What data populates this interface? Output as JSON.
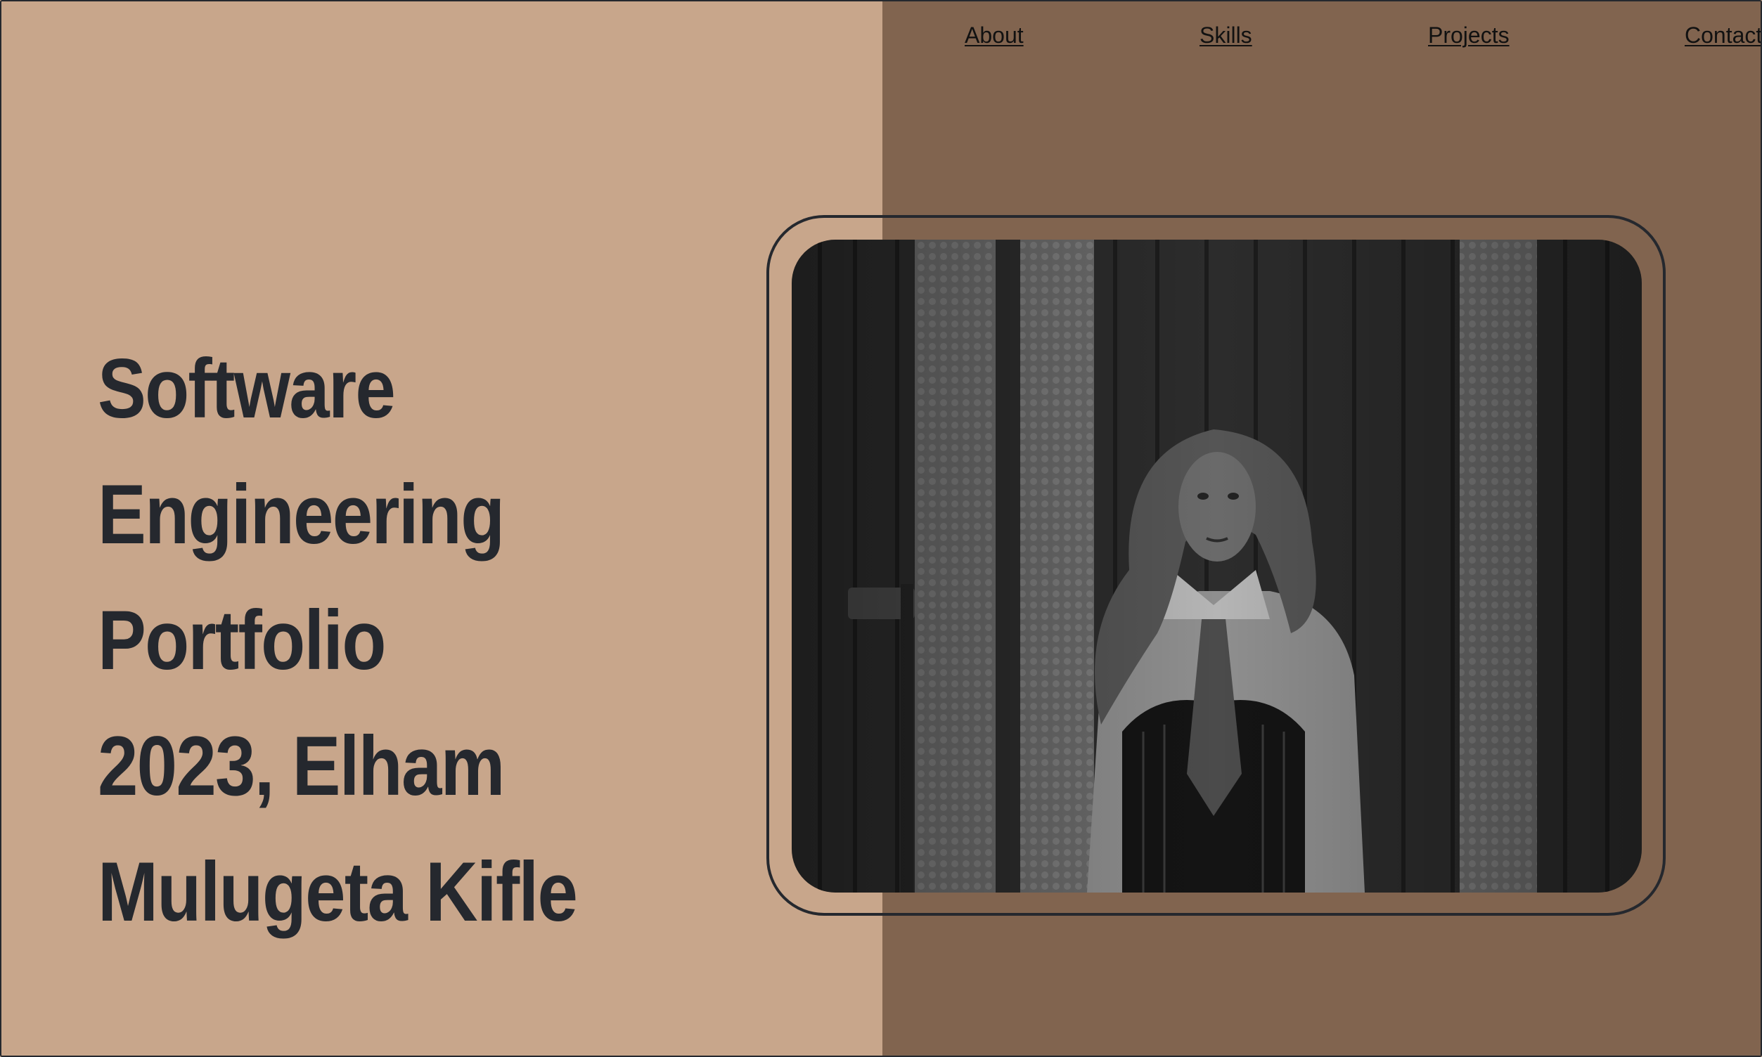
{
  "nav": {
    "about": "About",
    "skills": "Skills",
    "projects": "Projects",
    "contact": "Contact"
  },
  "hero": {
    "title_lines": [
      "Software",
      "Engineering",
      "Portfolio",
      "2023, Elham",
      "Mulugeta Kifle"
    ]
  },
  "photo": {
    "icon": "portrait-photo",
    "alt": ""
  },
  "colors": {
    "left_background": "#c8a68b",
    "right_background": "#81644f",
    "text_dark": "#25282e",
    "frame_border": "#25282e"
  }
}
